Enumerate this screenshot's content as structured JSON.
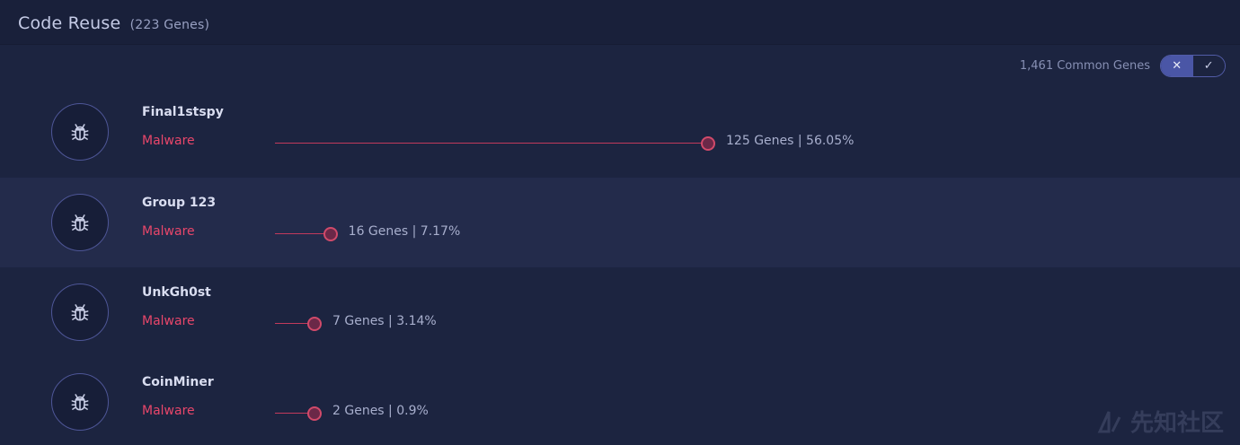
{
  "header": {
    "title": "Code Reuse",
    "count": "(223 Genes)"
  },
  "common": {
    "label": "1,461 Common Genes"
  },
  "toggle": {
    "reject": "✕",
    "accept": "✓"
  },
  "rows": [
    {
      "name": "Final1stspy",
      "type": "Malware",
      "stats": "125 Genes | 56.05%",
      "genes": 125,
      "percent": 56.05
    },
    {
      "name": "Group 123",
      "type": "Malware",
      "stats": "16 Genes | 7.17%",
      "genes": 16,
      "percent": 7.17
    },
    {
      "name": "UnkGh0st",
      "type": "Malware",
      "stats": "7 Genes | 3.14%",
      "genes": 7,
      "percent": 3.14
    },
    {
      "name": "CoinMiner",
      "type": "Malware",
      "stats": "2 Genes | 0.9%",
      "genes": 2,
      "percent": 0.9
    }
  ],
  "icons": {
    "avatar": "bug-icon"
  },
  "watermark": {
    "text": "先知社区"
  },
  "colors": {
    "accent": "#e8466a",
    "background": "#1c2440",
    "highlight": "#232b4b"
  }
}
